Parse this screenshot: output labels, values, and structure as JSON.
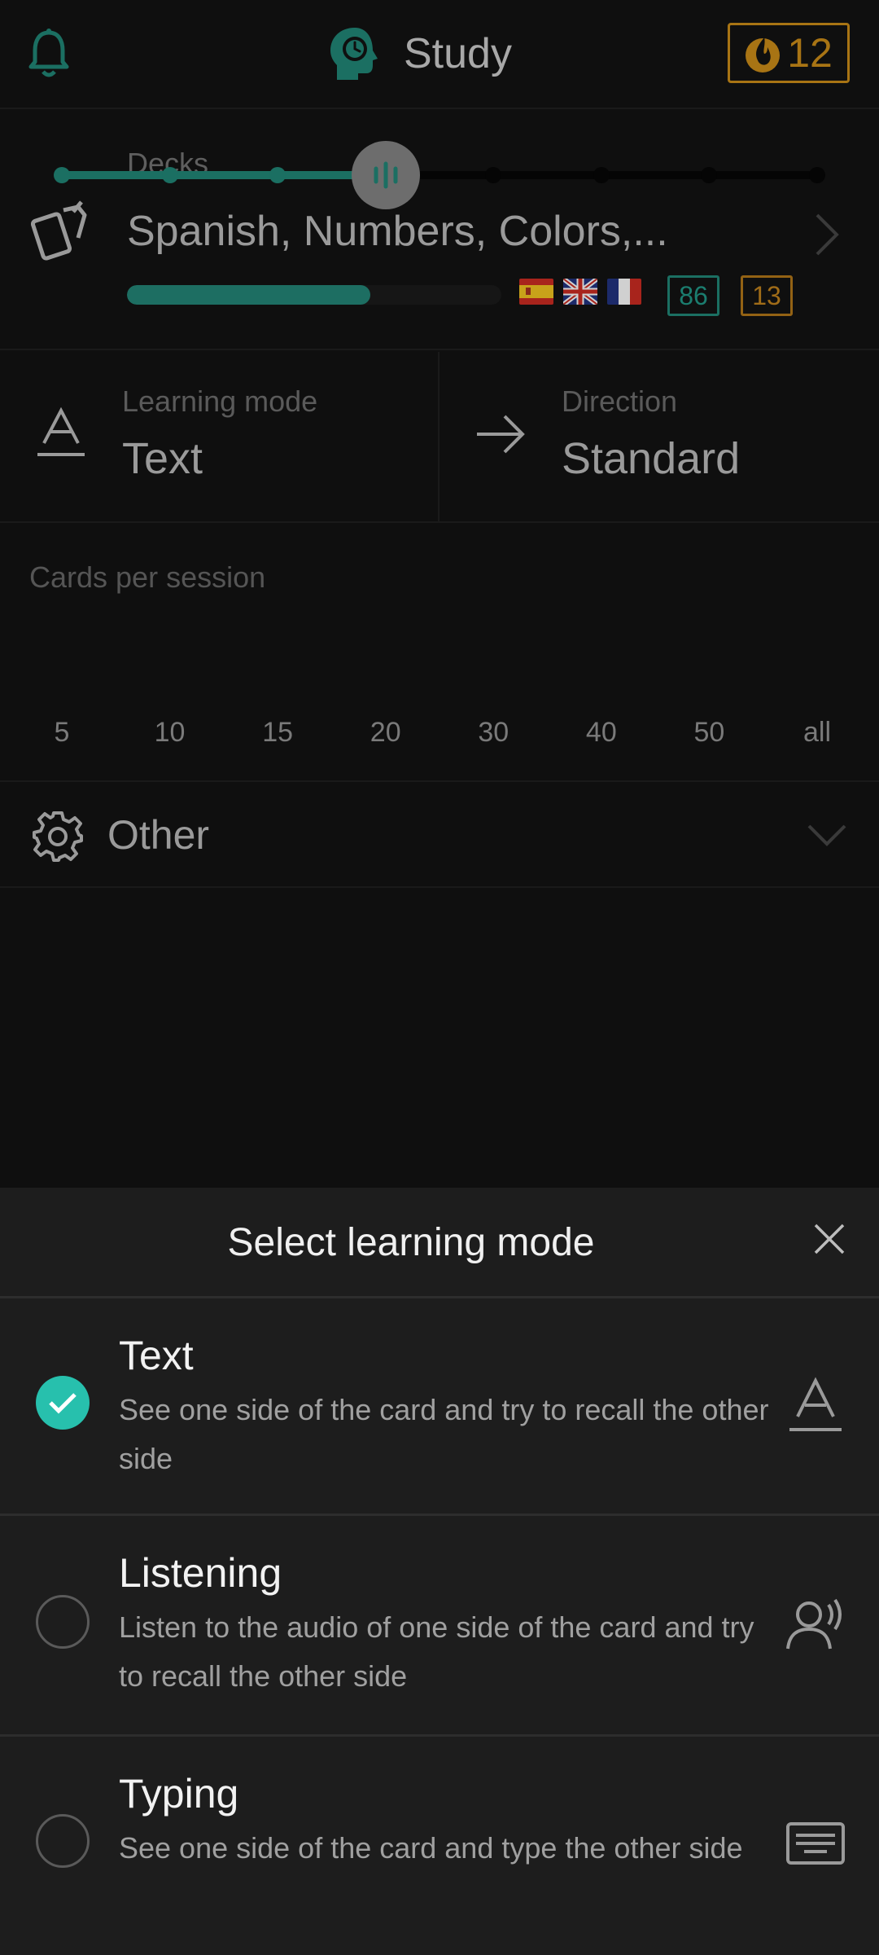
{
  "header": {
    "title": "Study",
    "streak_count": "12",
    "accent_color": "#1b6f62",
    "streak_color": "#a87414"
  },
  "decks": {
    "label": "Decks",
    "value": "Spanish, Numbers, Colors,...",
    "progress_fraction": 0.65,
    "flags": [
      "flag-es-icon",
      "flag-uk-icon",
      "flag-fr-icon"
    ],
    "count_new": "86",
    "count_due": "13"
  },
  "learning_mode": {
    "label": "Learning mode",
    "value": "Text"
  },
  "direction": {
    "label": "Direction",
    "value": "Standard"
  },
  "session": {
    "label": "Cards per session",
    "ticks": [
      "5",
      "10",
      "15",
      "20",
      "30",
      "40",
      "50",
      "all"
    ],
    "selected_index": 3
  },
  "other": {
    "label": "Other"
  },
  "sheet": {
    "title": "Select learning mode",
    "options": [
      {
        "name": "Text",
        "desc": "See one side of the card and try to recall the other side",
        "selected": true,
        "icon": "text-mode-icon"
      },
      {
        "name": "Listening",
        "desc": "Listen to the audio of one side of the card and try to recall the other side",
        "selected": false,
        "icon": "listening-icon"
      },
      {
        "name": "Typing",
        "desc": "See one side of the card and type the other side",
        "selected": false,
        "icon": "keyboard-icon"
      }
    ]
  }
}
